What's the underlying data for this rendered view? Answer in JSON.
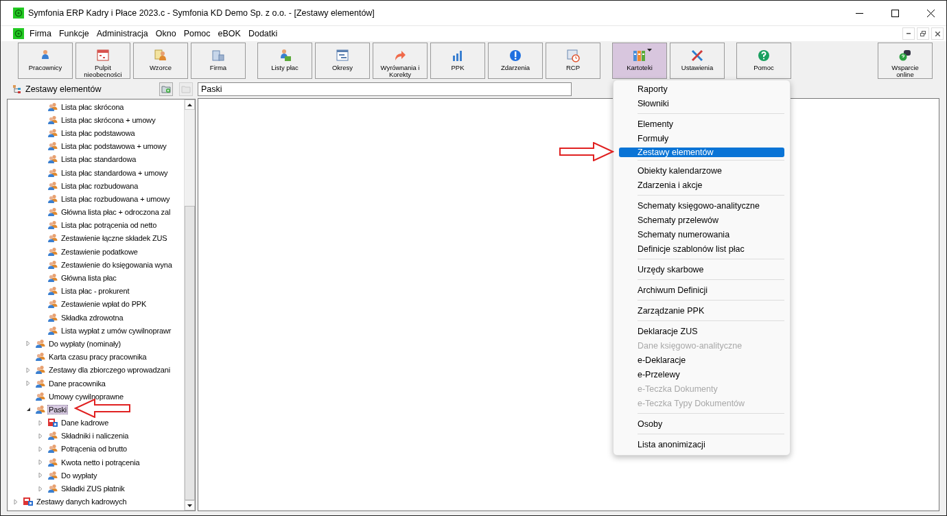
{
  "window": {
    "title": "Symfonia ERP Kadry i Płace 2023.c - Symfonia KD Demo Sp. z o.o. - [Zestawy elementów]"
  },
  "menu_bar": [
    "Firma",
    "Funkcje",
    "Administracja",
    "Okno",
    "Pomoc",
    "eBOK",
    "Dodatki"
  ],
  "toolbar": {
    "groups": [
      {
        "buttons": [
          {
            "label": "Pracownicy",
            "selected": false
          },
          {
            "label": "Pulpit nieobecności",
            "selected": false
          },
          {
            "label": "Wzorce",
            "selected": false
          },
          {
            "label": "Firma",
            "selected": false
          }
        ]
      },
      {
        "buttons": [
          {
            "label": "Listy płac",
            "selected": false
          },
          {
            "label": "Okresy",
            "selected": false
          },
          {
            "label": "Wyrównania i Korekty",
            "selected": false
          },
          {
            "label": "PPK",
            "selected": false
          },
          {
            "label": "Zdarzenia",
            "selected": false
          },
          {
            "label": "RCP",
            "selected": false
          }
        ]
      },
      {
        "buttons": [
          {
            "label": "Kartoteki",
            "selected": true
          },
          {
            "label": "Ustawienia",
            "selected": false
          }
        ]
      },
      {
        "buttons": [
          {
            "label": "Pomoc",
            "selected": false
          }
        ]
      },
      {
        "buttons": [
          {
            "label": "Wsparcie online",
            "selected": false
          }
        ]
      }
    ]
  },
  "left_panel": {
    "title": "Zestawy elementów",
    "tree": [
      {
        "children": [
          {
            "children": [
              {
                "label": "Lista płac skrócona",
                "kind": "group",
                "selected": false
              },
              {
                "label": "Lista płac skrócona + umowy",
                "kind": "group",
                "selected": false
              },
              {
                "label": "Lista płac podstawowa",
                "kind": "group",
                "selected": false
              },
              {
                "label": "Lista płac podstawowa + umowy",
                "kind": "group",
                "selected": false
              },
              {
                "label": "Lista płac standardowa",
                "kind": "group",
                "selected": false
              },
              {
                "label": "Lista płac standardowa + umowy",
                "kind": "group",
                "selected": false
              },
              {
                "label": "Lista płac rozbudowana",
                "kind": "group",
                "selected": false
              },
              {
                "label": "Lista płac rozbudowana + umowy",
                "kind": "group",
                "selected": false
              },
              {
                "label": "Główna lista płac + odroczona zal",
                "kind": "group",
                "selected": false
              },
              {
                "label": "Lista płac potrącenia od netto",
                "kind": "group",
                "selected": false
              },
              {
                "label": "Zestawienie łączne składek ZUS",
                "kind": "group",
                "selected": false
              },
              {
                "label": "Zestawienie podatkowe",
                "kind": "group",
                "selected": false
              },
              {
                "label": "Zestawienie do księgowania wyna",
                "kind": "group",
                "selected": false
              },
              {
                "label": "Główna lista płac",
                "kind": "group",
                "selected": false
              },
              {
                "label": "Lista płac - prokurent",
                "kind": "group",
                "selected": false
              },
              {
                "label": "Zestawienie wpłat do PPK",
                "kind": "group",
                "selected": false
              },
              {
                "label": "Składka zdrowotna",
                "kind": "group",
                "selected": false
              },
              {
                "label": "Lista wypłat z umów cywilnoprawr",
                "kind": "group",
                "selected": false
              }
            ]
          },
          {
            "label": "Do wypłaty (nominały)",
            "kind": "group",
            "expanded": false,
            "selected": false
          },
          {
            "label": "Karta czasu pracy pracownika",
            "kind": "group",
            "selected": false
          },
          {
            "label": "Zestawy dla zbiorczego wprowadzani",
            "kind": "group",
            "expanded": false,
            "selected": false
          },
          {
            "label": "Dane pracownika",
            "kind": "group",
            "expanded": false,
            "selected": false
          },
          {
            "label": "Umowy cywilnoprawne",
            "kind": "group",
            "selected": false
          },
          {
            "label": "Paski",
            "kind": "group",
            "expanded": true,
            "selected": true,
            "children": [
              {
                "label": "Dane kadrowe",
                "kind": "data",
                "expanded": false,
                "selected": false
              },
              {
                "label": "Składniki i naliczenia",
                "kind": "group",
                "expanded": false,
                "selected": false
              },
              {
                "label": "Potrącenia od brutto",
                "kind": "group",
                "expanded": false,
                "selected": false
              },
              {
                "label": "Kwota netto i potrącenia",
                "kind": "group",
                "expanded": false,
                "selected": false
              },
              {
                "label": "Do wypłaty",
                "kind": "group",
                "expanded": false,
                "selected": false
              },
              {
                "label": "Składki ZUS płatnik",
                "kind": "group",
                "expanded": false,
                "selected": false
              }
            ]
          }
        ]
      },
      {
        "label": "Zestawy danych kadrowych",
        "kind": "data",
        "expanded": false,
        "selected": false
      }
    ]
  },
  "detail": {
    "name_field": "Paski"
  },
  "dropdown_menu": {
    "items": [
      {
        "kind": "item",
        "label": "Raporty",
        "selected": false,
        "disabled": false
      },
      {
        "kind": "item",
        "label": "Słowniki",
        "selected": false,
        "disabled": false
      },
      {
        "kind": "separator"
      },
      {
        "kind": "item",
        "label": "Elementy",
        "selected": false,
        "disabled": false
      },
      {
        "kind": "item",
        "label": "Formuły",
        "selected": false,
        "disabled": false
      },
      {
        "kind": "item",
        "label": "Zestawy elementów",
        "selected": true,
        "disabled": false
      },
      {
        "kind": "separator"
      },
      {
        "kind": "item",
        "label": "Obiekty kalendarzowe",
        "selected": false,
        "disabled": false
      },
      {
        "kind": "item",
        "label": "Zdarzenia i akcje",
        "selected": false,
        "disabled": false
      },
      {
        "kind": "separator"
      },
      {
        "kind": "item",
        "label": "Schematy księgowo-analityczne",
        "selected": false,
        "disabled": false
      },
      {
        "kind": "item",
        "label": "Schematy przelewów",
        "selected": false,
        "disabled": false
      },
      {
        "kind": "item",
        "label": "Schematy numerowania",
        "selected": false,
        "disabled": false
      },
      {
        "kind": "item",
        "label": "Definicje szablonów list płac",
        "selected": false,
        "disabled": false
      },
      {
        "kind": "separator"
      },
      {
        "kind": "item",
        "label": "Urzędy skarbowe",
        "selected": false,
        "disabled": false
      },
      {
        "kind": "separator"
      },
      {
        "kind": "item",
        "label": "Archiwum Definicji",
        "selected": false,
        "disabled": false
      },
      {
        "kind": "separator"
      },
      {
        "kind": "item",
        "label": "Zarządzanie PPK",
        "selected": false,
        "disabled": false
      },
      {
        "kind": "separator"
      },
      {
        "kind": "item",
        "label": "Deklaracje ZUS",
        "selected": false,
        "disabled": false
      },
      {
        "kind": "item",
        "label": "Dane księgowo-analityczne",
        "selected": false,
        "disabled": true
      },
      {
        "kind": "item",
        "label": "e-Deklaracje",
        "selected": false,
        "disabled": false
      },
      {
        "kind": "item",
        "label": "e-Przelewy",
        "selected": false,
        "disabled": false
      },
      {
        "kind": "item",
        "label": "e-Teczka Dokumenty",
        "selected": false,
        "disabled": true
      },
      {
        "kind": "item",
        "label": "e-Teczka Typy Dokumentów",
        "selected": false,
        "disabled": true
      },
      {
        "kind": "separator"
      },
      {
        "kind": "item",
        "label": "Osoby",
        "selected": false,
        "disabled": false
      },
      {
        "kind": "separator"
      },
      {
        "kind": "item",
        "label": "Lista anonimizacji",
        "selected": false,
        "disabled": false
      }
    ]
  }
}
